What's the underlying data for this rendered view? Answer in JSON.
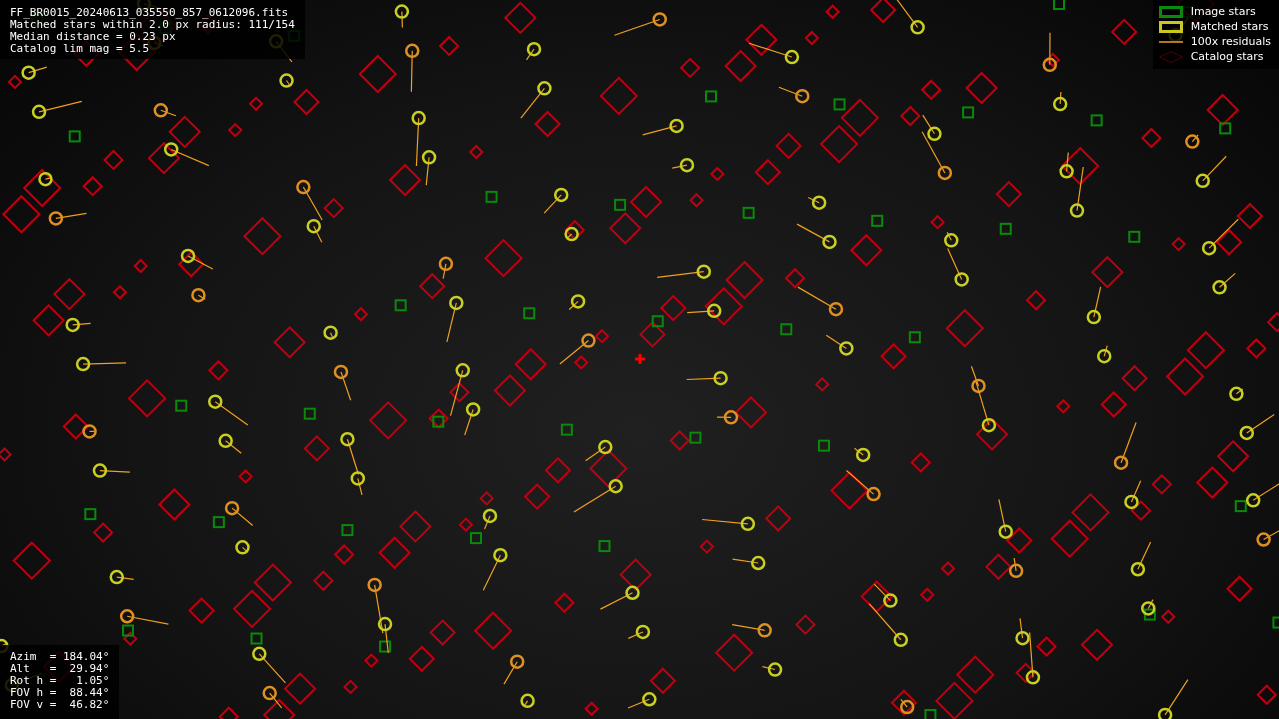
{
  "info": {
    "lines": [
      "FF_BR0015_20240613_035550_857_0612096.fits",
      "Matched stars within 2.0 px radius: 111/154",
      "Median distance = 0.23 px",
      "Catalog lim mag = 5.5"
    ]
  },
  "legend": [
    {
      "kind": "image",
      "label": "Image stars"
    },
    {
      "kind": "matched",
      "label": "Matched stars"
    },
    {
      "kind": "residual",
      "label": "100x residuals"
    },
    {
      "kind": "catalog",
      "label": "Catalog stars"
    }
  ],
  "pointing": {
    "lines": [
      "Azim  = 184.04°",
      "Alt   =  29.94°",
      "Rot h =   1.05°",
      "FOV h =  88.44°",
      "FOV v =  46.82°"
    ]
  }
}
